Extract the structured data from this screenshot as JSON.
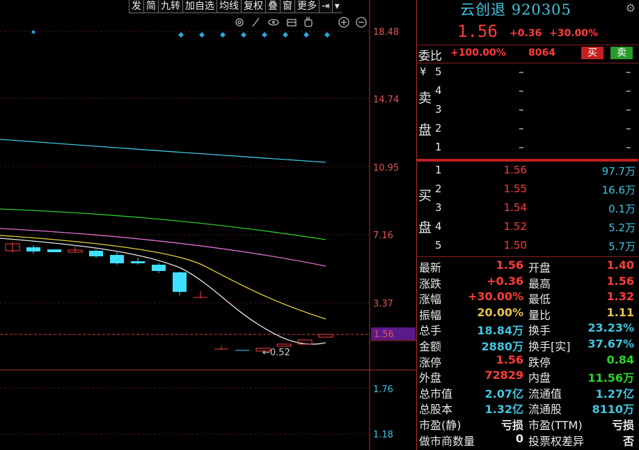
{
  "toolbar": {
    "buttons": [
      "发",
      "简",
      "九转",
      "加自选",
      "均线",
      "复权",
      "叠",
      "窗",
      "更多"
    ]
  },
  "chart": {
    "price_labels": [
      "18.48",
      "14.74",
      "10.95",
      "7.16",
      "3.37",
      "1.56",
      "1.76",
      "1.18"
    ],
    "current_price_tag": "1.56",
    "low_annotation": "←0.52"
  },
  "quote": {
    "name": "云创退",
    "code": "920305",
    "price": "1.56",
    "change": "+0.36",
    "change_pct": "+30.00%",
    "weibi_label": "委比",
    "weibi_value": "+100.00%",
    "weicha": "8064",
    "buy_btn": "买",
    "sell_btn": "卖",
    "sell_side_label": [
      "卖",
      "盘"
    ],
    "yen": "¥",
    "sell": [
      {
        "level": "5",
        "price": "–",
        "vol": "–"
      },
      {
        "level": "4",
        "price": "–",
        "vol": "–"
      },
      {
        "level": "3",
        "price": "–",
        "vol": "–"
      },
      {
        "level": "2",
        "price": "–",
        "vol": "–"
      },
      {
        "level": "1",
        "price": "–",
        "vol": "–"
      }
    ],
    "buy_side_label": [
      "买",
      "盘"
    ],
    "buy": [
      {
        "level": "1",
        "price": "1.56",
        "vol": "97.7万"
      },
      {
        "level": "2",
        "price": "1.55",
        "vol": "16.6万"
      },
      {
        "level": "3",
        "price": "1.54",
        "vol": "0.1万"
      },
      {
        "level": "4",
        "price": "1.52",
        "vol": "5.2万"
      },
      {
        "level": "5",
        "price": "1.50",
        "vol": "5.7万"
      }
    ],
    "stats": [
      {
        "l1": "最新",
        "v1": "1.56",
        "c1": "red",
        "l2": "开盘",
        "v2": "1.40",
        "c2": "red"
      },
      {
        "l1": "涨跌",
        "v1": "+0.36",
        "c1": "red",
        "l2": "最高",
        "v2": "1.56",
        "c2": "red"
      },
      {
        "l1": "涨幅",
        "v1": "+30.00%",
        "c1": "red",
        "l2": "最低",
        "v2": "1.32",
        "c2": "red"
      },
      {
        "l1": "振幅",
        "v1": "20.00%",
        "c1": "yellow",
        "l2": "量比",
        "v2": "1.11",
        "c2": "yellow"
      },
      {
        "l1": "总手",
        "v1": "18.84万",
        "c1": "cyan",
        "l2": "换手",
        "v2": "23.23%",
        "c2": "cyan"
      },
      {
        "l1": "金额",
        "v1": "2880万",
        "c1": "cyan",
        "l2": "换手[实]",
        "v2": "37.67%",
        "c2": "cyan"
      },
      {
        "l1": "涨停",
        "v1": "1.56",
        "c1": "red",
        "l2": "跌停",
        "v2": "0.84",
        "c2": "green"
      },
      {
        "l1": "外盘",
        "v1": "72829",
        "c1": "red",
        "l2": "内盘",
        "v2": "11.56万",
        "c2": "green"
      },
      {
        "l1": "总市值",
        "v1": "2.07亿",
        "c1": "cyan",
        "l2": "流通值",
        "v2": "1.27亿",
        "c2": "cyan"
      },
      {
        "l1": "总股本",
        "v1": "1.32亿",
        "c1": "cyan",
        "l2": "流通股",
        "v2": "8110万",
        "c2": "cyan"
      },
      {
        "l1": "市盈(静)",
        "v1": "亏损",
        "c1": "white",
        "l2": "市盈(TTM)",
        "v2": "亏损",
        "c2": "white"
      },
      {
        "l1": "做市商数量",
        "v1": "0",
        "c1": "white",
        "l2": "投票权差异",
        "v2": "否",
        "c2": "white"
      }
    ]
  }
}
